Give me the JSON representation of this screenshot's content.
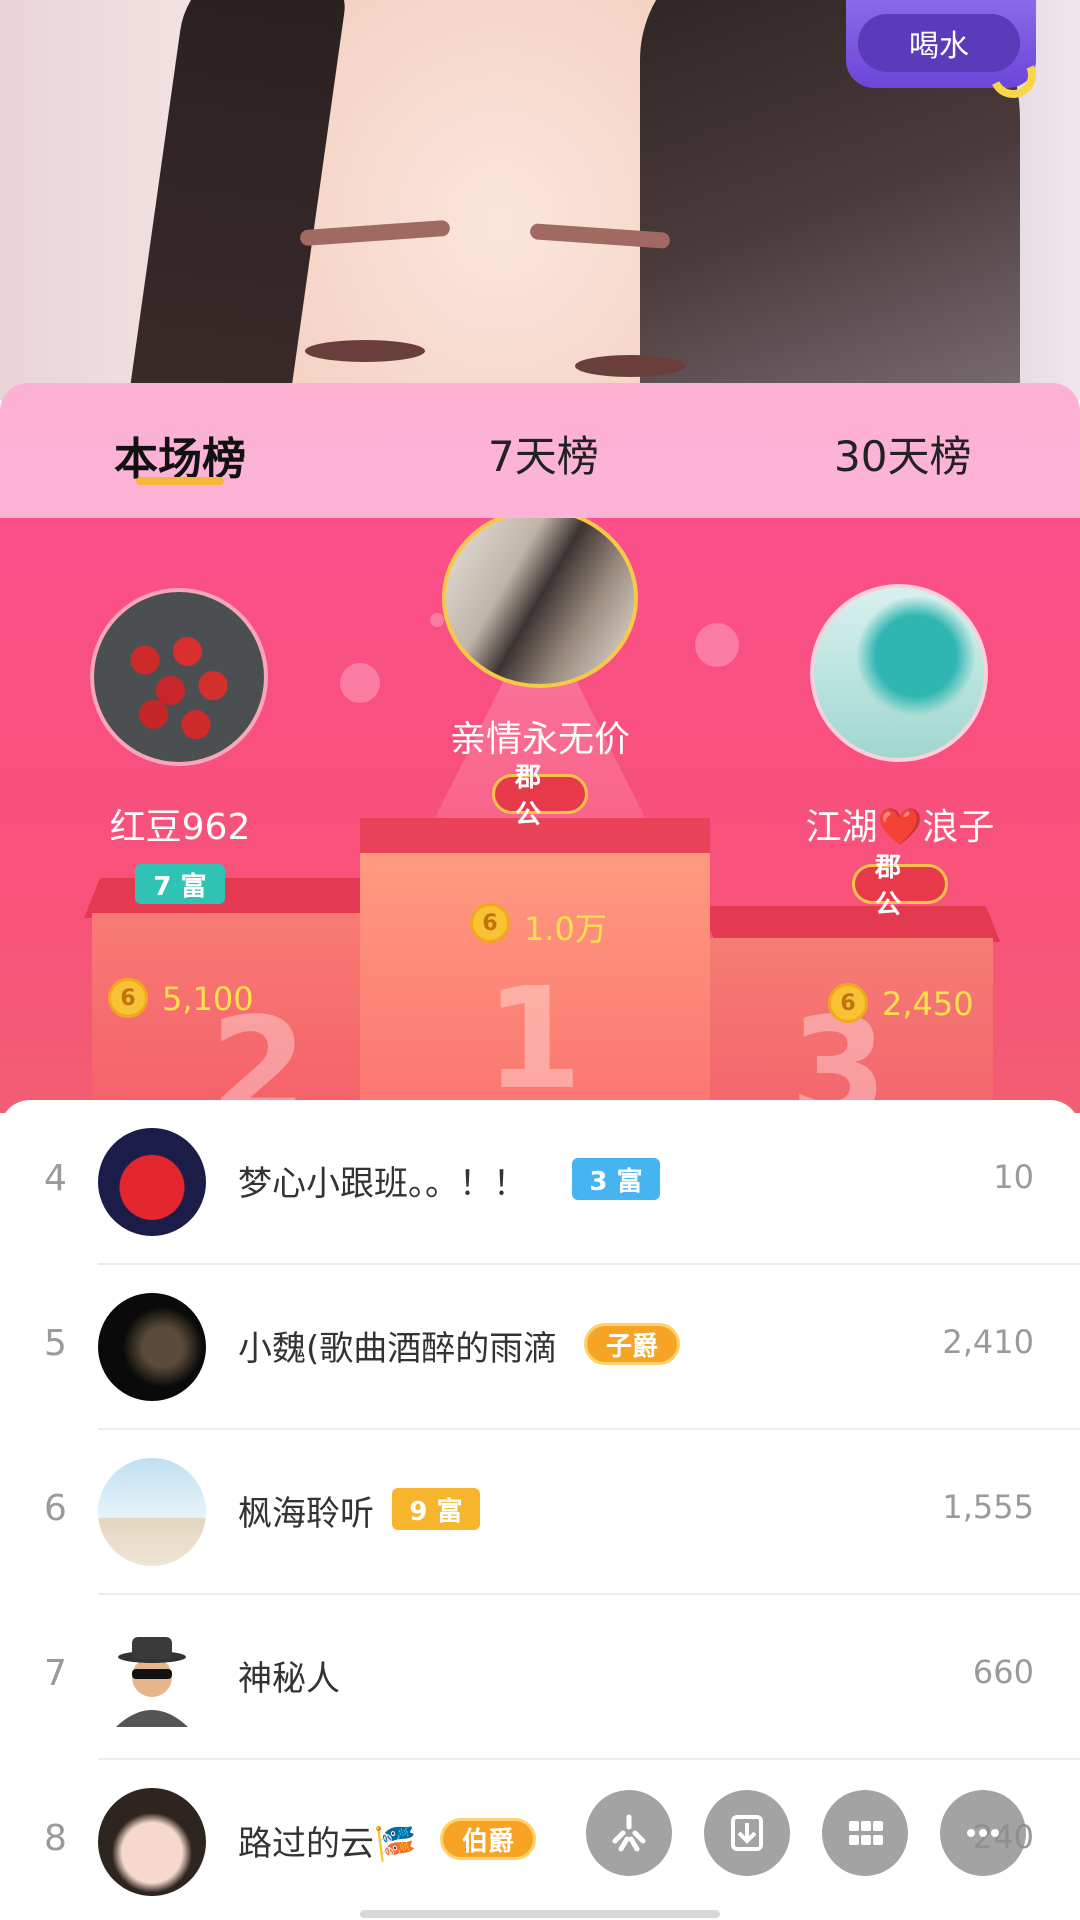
{
  "video": {
    "pill_label": "喝水"
  },
  "tabs": [
    {
      "label": "本场榜",
      "active": true
    },
    {
      "label": "7天榜",
      "active": false
    },
    {
      "label": "30天榜",
      "active": false
    }
  ],
  "podium": {
    "first": {
      "name": "亲情永无价",
      "badge": "郡公",
      "score": "1.0万",
      "coin": "6"
    },
    "second": {
      "name": "红豆962",
      "badge": "7 富",
      "score": "5,100",
      "coin": "6"
    },
    "third": {
      "name": "江湖❤️浪子",
      "badge": "郡公",
      "score": "2,450",
      "coin": "6"
    },
    "numbers": [
      "1",
      "2",
      "3"
    ]
  },
  "list": [
    {
      "rank": "4",
      "name": "梦心小跟班。。！！",
      "badge": "3 富",
      "badge_color": "#45b4f0",
      "value": "10"
    },
    {
      "rank": "5",
      "name": "小魏(歌曲酒醉的雨滴",
      "badge": "子爵",
      "value": "2,410"
    },
    {
      "rank": "6",
      "name": "枫海聆听",
      "badge": "9 富",
      "badge_color": "#f6b52c",
      "value": "1,555"
    },
    {
      "rank": "7",
      "name": "神秘人",
      "value": "660"
    },
    {
      "rank": "8",
      "name": "路过的云🎏",
      "badge": "伯爵",
      "value": "240"
    }
  ],
  "colors": {
    "accent_pink": "#fa4f8a",
    "tab_bg": "#fdb1d3",
    "gold": "#ffe14d"
  },
  "fab_icons": [
    "sparkle-icon",
    "download-icon",
    "grid-icon",
    "more-icon"
  ]
}
